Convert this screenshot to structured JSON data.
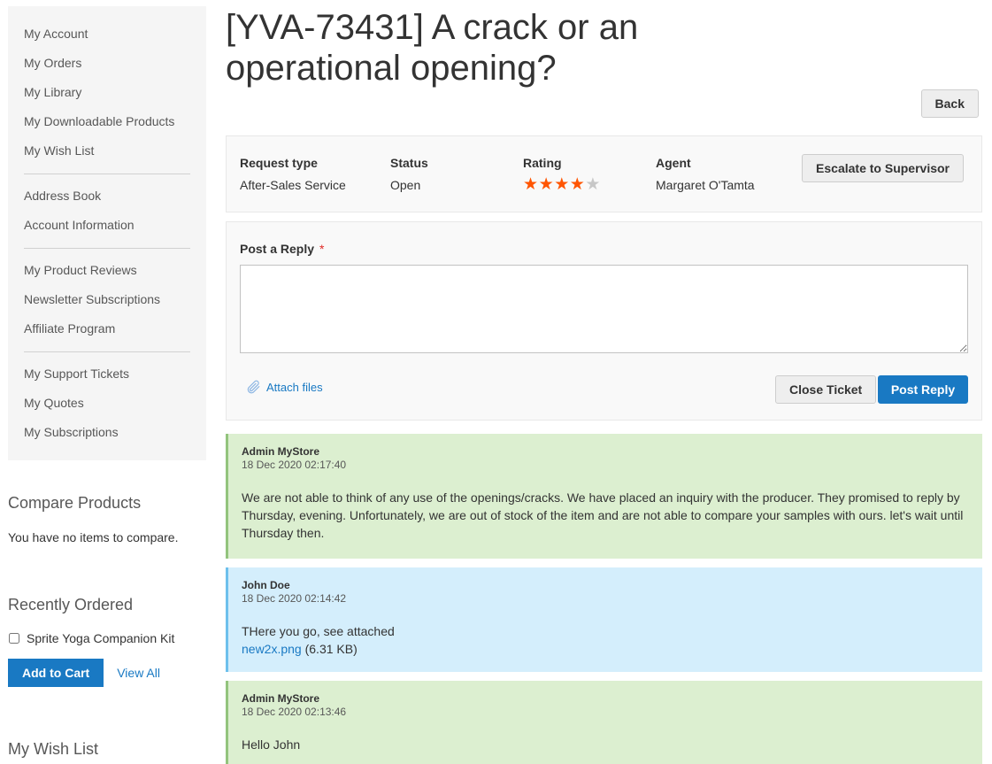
{
  "sidebar": {
    "nav_groups": [
      [
        {
          "label": "My Account"
        },
        {
          "label": "My Orders"
        },
        {
          "label": "My Library"
        },
        {
          "label": "My Downloadable Products"
        },
        {
          "label": "My Wish List"
        }
      ],
      [
        {
          "label": "Address Book"
        },
        {
          "label": "Account Information"
        }
      ],
      [
        {
          "label": "My Product Reviews"
        },
        {
          "label": "Newsletter Subscriptions"
        },
        {
          "label": "Affiliate Program"
        }
      ],
      [
        {
          "label": "My Support Tickets"
        },
        {
          "label": "My Quotes"
        },
        {
          "label": "My Subscriptions"
        }
      ]
    ],
    "compare": {
      "title": "Compare Products",
      "empty_text": "You have no items to compare."
    },
    "recent": {
      "title": "Recently Ordered",
      "item_label": "Sprite Yoga Companion Kit",
      "item_checked": false,
      "add_to_cart_label": "Add to Cart",
      "view_all_label": "View All"
    },
    "wishlist": {
      "title": "My Wish List"
    }
  },
  "ticket": {
    "title": "[YVA-73431] A crack or an operational opening?",
    "back_label": "Back",
    "info": {
      "request_type_label": "Request type",
      "request_type_value": "After-Sales Service",
      "status_label": "Status",
      "status_value": "Open",
      "rating_label": "Rating",
      "rating_value": 4,
      "rating_max": 5,
      "agent_label": "Agent",
      "agent_value": "Margaret O'Tamta",
      "escalate_label": "Escalate to Supervisor"
    },
    "reply": {
      "label": "Post a Reply",
      "required_mark": "*",
      "textarea_value": "",
      "attach_label": "Attach files",
      "close_label": "Close Ticket",
      "post_label": "Post Reply"
    },
    "colors": {
      "star_on": "#ff5501",
      "star_off": "#c7c7c7",
      "admin_bg": "#dcefd0",
      "customer_bg": "#d4eefc",
      "primary": "#1979c3"
    },
    "messages": [
      {
        "type": "admin",
        "author": "Admin MyStore",
        "date": "18 Dec 2020 02:17:40",
        "body": "We are not able to think of any use of the openings/cracks. We have placed an inquiry with the producer. They promised to reply by Thursday, evening. Unfortunately, we are out of stock of the item and are not able to compare your samples with ours. let's wait until Thursday then."
      },
      {
        "type": "customer",
        "author": "John Doe",
        "date": "18 Dec 2020 02:14:42",
        "body": "THere you go, see attached",
        "attachment_name": "new2x.png",
        "attachment_size": "(6.31 KB)"
      },
      {
        "type": "admin",
        "author": "Admin MyStore",
        "date": "18 Dec 2020 02:13:46",
        "body": "Hello John"
      }
    ]
  }
}
